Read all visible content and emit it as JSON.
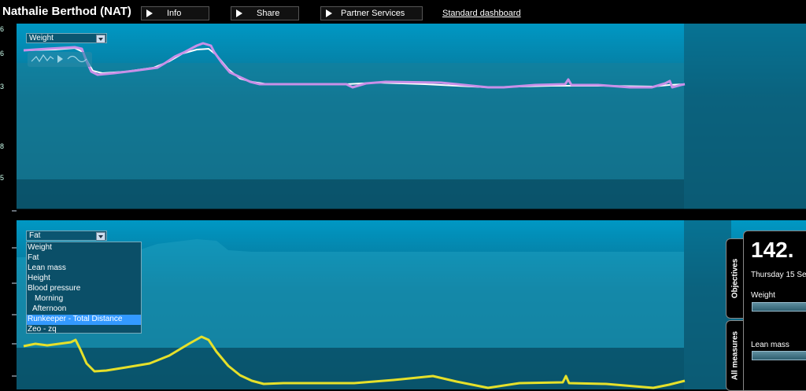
{
  "header": {
    "user_name": "Nathalie Berthod (NAT)",
    "buttons": [
      {
        "label": "Info"
      },
      {
        "label": "Share"
      },
      {
        "label": "Partner Services"
      }
    ],
    "dashboard_link": "Standard dashboard"
  },
  "top_chart": {
    "selected_measure": "Weight",
    "ytick_labels": [
      "6",
      "3",
      "8",
      "5"
    ]
  },
  "bottom_chart": {
    "selected_measure": "Fat"
  },
  "measure_dropdown": {
    "options": [
      "Weight",
      "Fat",
      "Lean mass",
      "Height",
      "Blood pressure",
      "Morning",
      "Afternoon",
      "Runkeeper - Total Distance",
      "Zeo - zq"
    ],
    "highlighted": "Runkeeper - Total Distance"
  },
  "side_panel": {
    "tabs": [
      "Objectives",
      "All measures"
    ],
    "big_value": "142.",
    "date": "Thursday 15 Se",
    "measures": [
      "Weight",
      "Lean mass"
    ]
  },
  "colors": {
    "panel_top": "#0098c4",
    "panel_bottom": "#0b5c76",
    "weight_line": "#c890e8",
    "trend_line": "#ffffff",
    "fat_line": "#e6e02a",
    "highlight": "#3399ff"
  },
  "icons": [
    "play-arrow-icon",
    "dropdown-chevron-icon",
    "sparkline-icon"
  ]
}
